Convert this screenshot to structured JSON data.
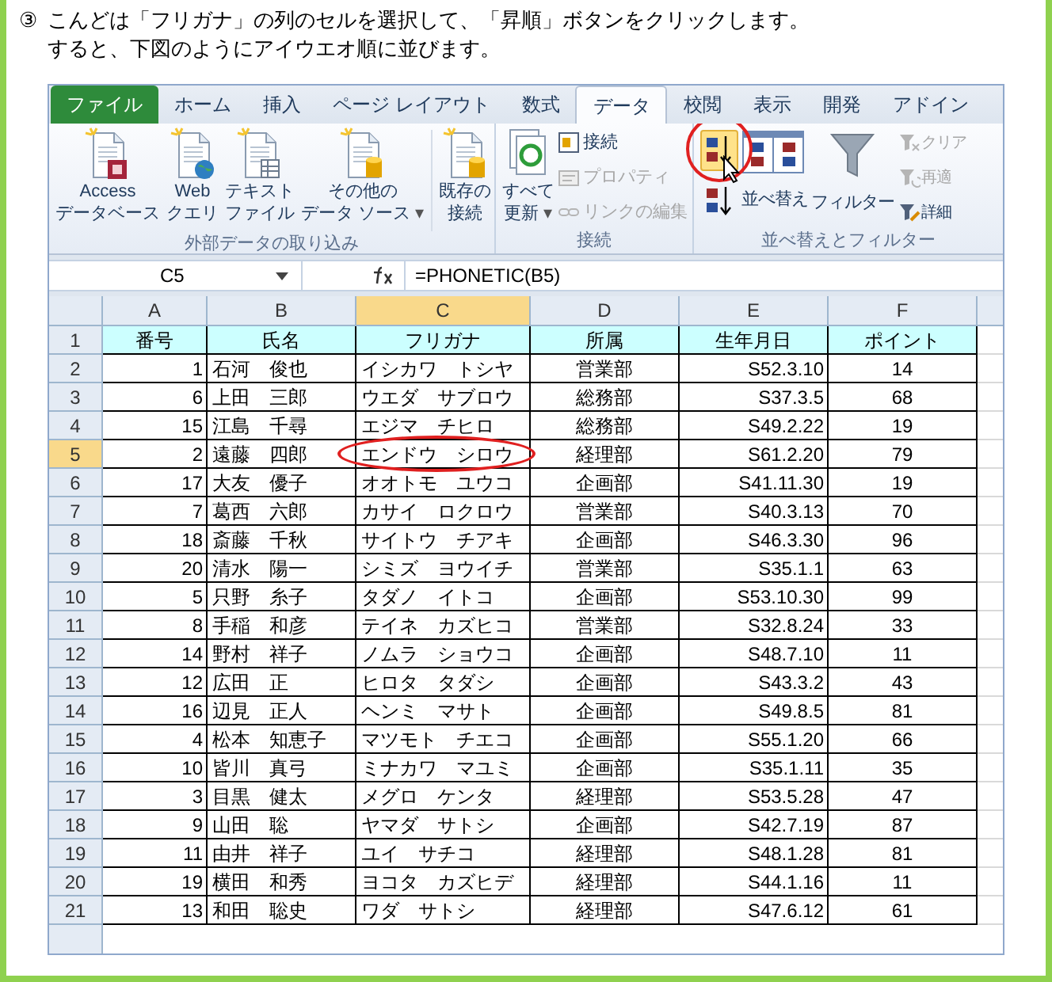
{
  "instruction": {
    "marker": "③",
    "lines": [
      "こんどは「フリガナ」の列のセルを選択して、「昇順」ボタンをクリックします。",
      "すると、下図のようにアイウエオ順に並びます。"
    ]
  },
  "ribbon_tabs": [
    {
      "label": "ファイル",
      "kind": "file",
      "selected": false
    },
    {
      "label": "ホーム",
      "kind": "tab",
      "selected": false
    },
    {
      "label": "挿入",
      "kind": "tab",
      "selected": false
    },
    {
      "label": "ページ レイアウト",
      "kind": "tab",
      "selected": false
    },
    {
      "label": "数式",
      "kind": "tab",
      "selected": false
    },
    {
      "label": "データ",
      "kind": "tab",
      "selected": true
    },
    {
      "label": "校閲",
      "kind": "tab",
      "selected": false
    },
    {
      "label": "表示",
      "kind": "tab",
      "selected": false
    },
    {
      "label": "開発",
      "kind": "tab",
      "selected": false
    },
    {
      "label": "アドイン",
      "kind": "tab",
      "selected": false
    }
  ],
  "external_data_group": {
    "label": "外部データの取り込み",
    "buttons": [
      {
        "lines": [
          "Access",
          "データベース"
        ]
      },
      {
        "lines": [
          "Web",
          "クエリ"
        ]
      },
      {
        "lines": [
          "テキスト",
          "ファイル"
        ]
      },
      {
        "lines": [
          "その他の",
          "データ ソース"
        ],
        "arrow": "▾"
      },
      {
        "lines": [
          "既存の",
          "接続"
        ]
      }
    ]
  },
  "connections_group": {
    "label": "接続",
    "refresh_button": {
      "lines": [
        "すべて",
        "更新"
      ],
      "arrow": "▾"
    },
    "small_buttons": [
      {
        "label": "接続",
        "disabled": false
      },
      {
        "label": "プロパティ",
        "disabled": true
      },
      {
        "label": "リンクの編集",
        "disabled": true
      }
    ]
  },
  "sort_filter_group": {
    "label": "並べ替えとフィルター",
    "sort_ascending": {
      "hovered": true,
      "circled": true
    },
    "sort_label": "並べ替え",
    "filter_label": "フィルター",
    "small_buttons": [
      {
        "label": "クリア",
        "disabled": true
      },
      {
        "label": "再適",
        "disabled": true
      },
      {
        "label": "詳細",
        "disabled": false
      }
    ]
  },
  "formula_bar": {
    "name_box": "C5",
    "formula": "=PHONETIC(B5)"
  },
  "columns": [
    {
      "letter": "A",
      "selected": false
    },
    {
      "letter": "B",
      "selected": false
    },
    {
      "letter": "C",
      "selected": true
    },
    {
      "letter": "D",
      "selected": false
    },
    {
      "letter": "E",
      "selected": false
    },
    {
      "letter": "F",
      "selected": false
    }
  ],
  "rows": [
    {
      "number": "1",
      "kind": "header",
      "selected": false,
      "circled": false,
      "cells": [
        "番号",
        "氏名",
        "フリガナ",
        "所属",
        "生年月日",
        "ポイント"
      ]
    },
    {
      "number": "2",
      "kind": "data",
      "selected": false,
      "circled": false,
      "cells": [
        "1",
        "石河　俊也",
        "イシカワ　トシヤ",
        "営業部",
        "S52.3.10",
        "14"
      ]
    },
    {
      "number": "3",
      "kind": "data",
      "selected": false,
      "circled": false,
      "cells": [
        "6",
        "上田　三郎",
        "ウエダ　サブロウ",
        "総務部",
        "S37.3.5",
        "68"
      ]
    },
    {
      "number": "4",
      "kind": "data",
      "selected": false,
      "circled": false,
      "cells": [
        "15",
        "江島　千尋",
        "エジマ　チヒロ",
        "総務部",
        "S49.2.22",
        "19"
      ]
    },
    {
      "number": "5",
      "kind": "data",
      "selected": true,
      "circled": true,
      "cells": [
        "2",
        "遠藤　四郎",
        "エンドウ　シロウ",
        "経理部",
        "S61.2.20",
        "79"
      ]
    },
    {
      "number": "6",
      "kind": "data",
      "selected": false,
      "circled": false,
      "cells": [
        "17",
        "大友　優子",
        "オオトモ　ユウコ",
        "企画部",
        "S41.11.30",
        "19"
      ]
    },
    {
      "number": "7",
      "kind": "data",
      "selected": false,
      "circled": false,
      "cells": [
        "7",
        "葛西　六郎",
        "カサイ　ロクロウ",
        "営業部",
        "S40.3.13",
        "70"
      ]
    },
    {
      "number": "8",
      "kind": "data",
      "selected": false,
      "circled": false,
      "cells": [
        "18",
        "斎藤　千秋",
        "サイトウ　チアキ",
        "企画部",
        "S46.3.30",
        "96"
      ]
    },
    {
      "number": "9",
      "kind": "data",
      "selected": false,
      "circled": false,
      "cells": [
        "20",
        "清水　陽一",
        "シミズ　ヨウイチ",
        "営業部",
        "S35.1.1",
        "63"
      ]
    },
    {
      "number": "10",
      "kind": "data",
      "selected": false,
      "circled": false,
      "cells": [
        "5",
        "只野　糸子",
        "タダノ　イトコ",
        "企画部",
        "S53.10.30",
        "99"
      ]
    },
    {
      "number": "11",
      "kind": "data",
      "selected": false,
      "circled": false,
      "cells": [
        "8",
        "手稲　和彦",
        "テイネ　カズヒコ",
        "営業部",
        "S32.8.24",
        "33"
      ]
    },
    {
      "number": "12",
      "kind": "data",
      "selected": false,
      "circled": false,
      "cells": [
        "14",
        "野村　祥子",
        "ノムラ　ショウコ",
        "企画部",
        "S48.7.10",
        "11"
      ]
    },
    {
      "number": "13",
      "kind": "data",
      "selected": false,
      "circled": false,
      "cells": [
        "12",
        "広田　正",
        "ヒロタ　タダシ",
        "企画部",
        "S43.3.2",
        "43"
      ]
    },
    {
      "number": "14",
      "kind": "data",
      "selected": false,
      "circled": false,
      "cells": [
        "16",
        "辺見　正人",
        "ヘンミ　マサト",
        "企画部",
        "S49.8.5",
        "81"
      ]
    },
    {
      "number": "15",
      "kind": "data",
      "selected": false,
      "circled": false,
      "cells": [
        "4",
        "松本　知恵子",
        "マツモト　チエコ",
        "企画部",
        "S55.1.20",
        "66"
      ]
    },
    {
      "number": "16",
      "kind": "data",
      "selected": false,
      "circled": false,
      "cells": [
        "10",
        "皆川　真弓",
        "ミナカワ　マユミ",
        "企画部",
        "S35.1.11",
        "35"
      ]
    },
    {
      "number": "17",
      "kind": "data",
      "selected": false,
      "circled": false,
      "cells": [
        "3",
        "目黒　健太",
        "メグロ　ケンタ",
        "経理部",
        "S53.5.28",
        "47"
      ]
    },
    {
      "number": "18",
      "kind": "data",
      "selected": false,
      "circled": false,
      "cells": [
        "9",
        "山田　聡",
        "ヤマダ　サトシ",
        "企画部",
        "S42.7.19",
        "87"
      ]
    },
    {
      "number": "19",
      "kind": "data",
      "selected": false,
      "circled": false,
      "cells": [
        "11",
        "由井　祥子",
        "ユイ　サチコ",
        "経理部",
        "S48.1.28",
        "81"
      ]
    },
    {
      "number": "20",
      "kind": "data",
      "selected": false,
      "circled": false,
      "cells": [
        "19",
        "横田　和秀",
        "ヨコタ　カズヒデ",
        "経理部",
        "S44.1.16",
        "11"
      ]
    },
    {
      "number": "21",
      "kind": "data",
      "selected": false,
      "circled": false,
      "cells": [
        "13",
        "和田　聡史",
        "ワダ　サトシ",
        "経理部",
        "S47.6.12",
        "61"
      ]
    }
  ]
}
